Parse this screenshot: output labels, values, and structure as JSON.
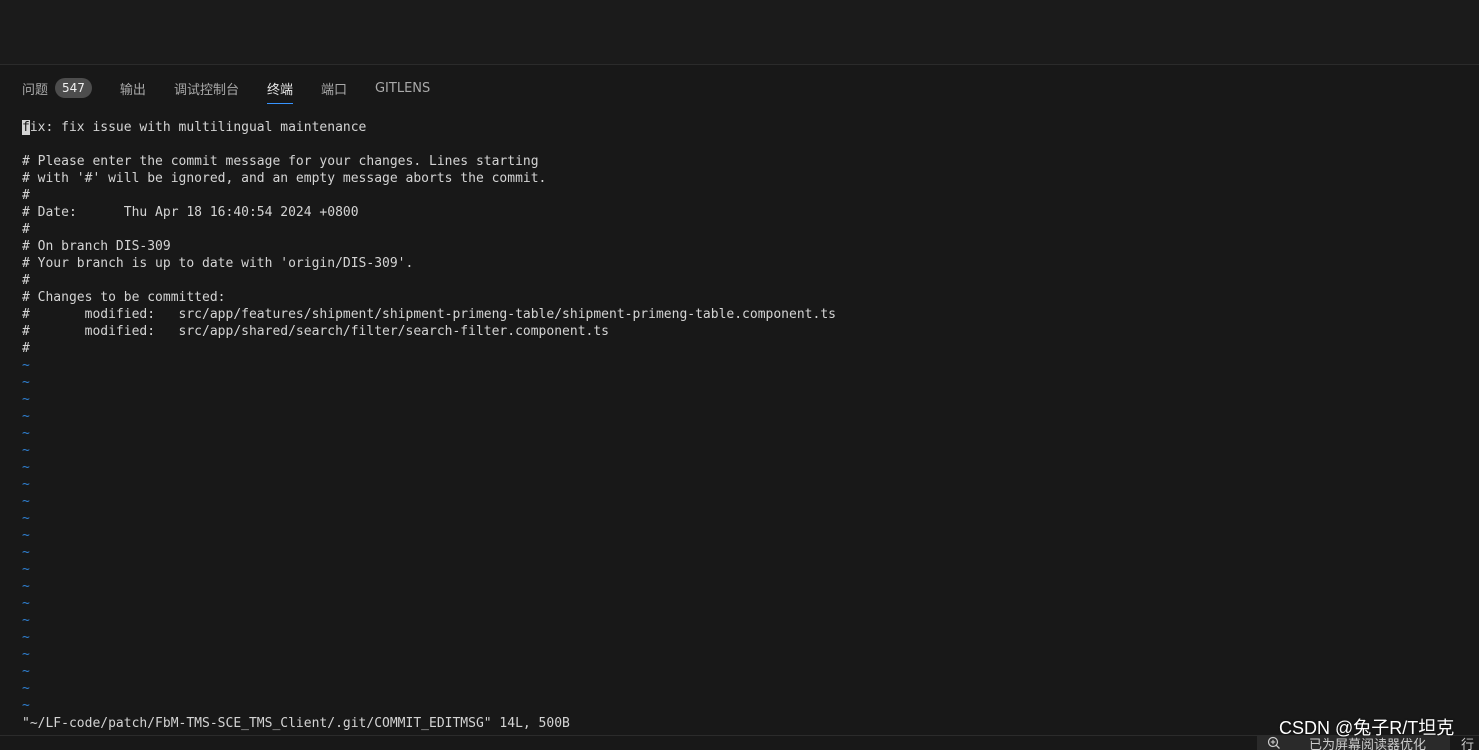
{
  "tabs": [
    {
      "label": "问题",
      "badge": "547",
      "active": false
    },
    {
      "label": "输出",
      "active": false
    },
    {
      "label": "调试控制台",
      "active": false
    },
    {
      "label": "终端",
      "active": true
    },
    {
      "label": "端口",
      "active": false
    },
    {
      "label": "GITLENS",
      "active": false
    }
  ],
  "terminal": {
    "cursor_char": "f",
    "first_line_rest": "ix: fix issue with multilingual maintenance",
    "lines": [
      "",
      "# Please enter the commit message for your changes. Lines starting",
      "# with '#' will be ignored, and an empty message aborts the commit.",
      "#",
      "# Date:      Thu Apr 18 16:40:54 2024 +0800",
      "#",
      "# On branch DIS-309",
      "# Your branch is up to date with 'origin/DIS-309'.",
      "#",
      "# Changes to be committed:",
      "#\tmodified:   src/app/features/shipment/shipment-primeng-table/shipment-primeng-table.component.ts",
      "#\tmodified:   src/app/shared/search/filter/search-filter.component.ts",
      "#"
    ],
    "tilde_char": "~",
    "tilde_count": 21,
    "status_line": "\"~/LF-code/patch/FbM-TMS-SCE_TMS_Client/.git/COMMIT_EDITMSG\" 14L, 500B"
  },
  "statusbar": {
    "screen_reader_icon": "zoom-icon",
    "screen_reader_label": "已为屏幕阅读器优化",
    "right_label": "行"
  },
  "watermark": "CSDN @兔子R/T坦克",
  "colors": {
    "background": "#181818",
    "text": "#d4d4d4",
    "tilde": "#2f7fd1",
    "active_tab_underline": "#3794ff",
    "badge_bg": "#4d4d4d"
  }
}
